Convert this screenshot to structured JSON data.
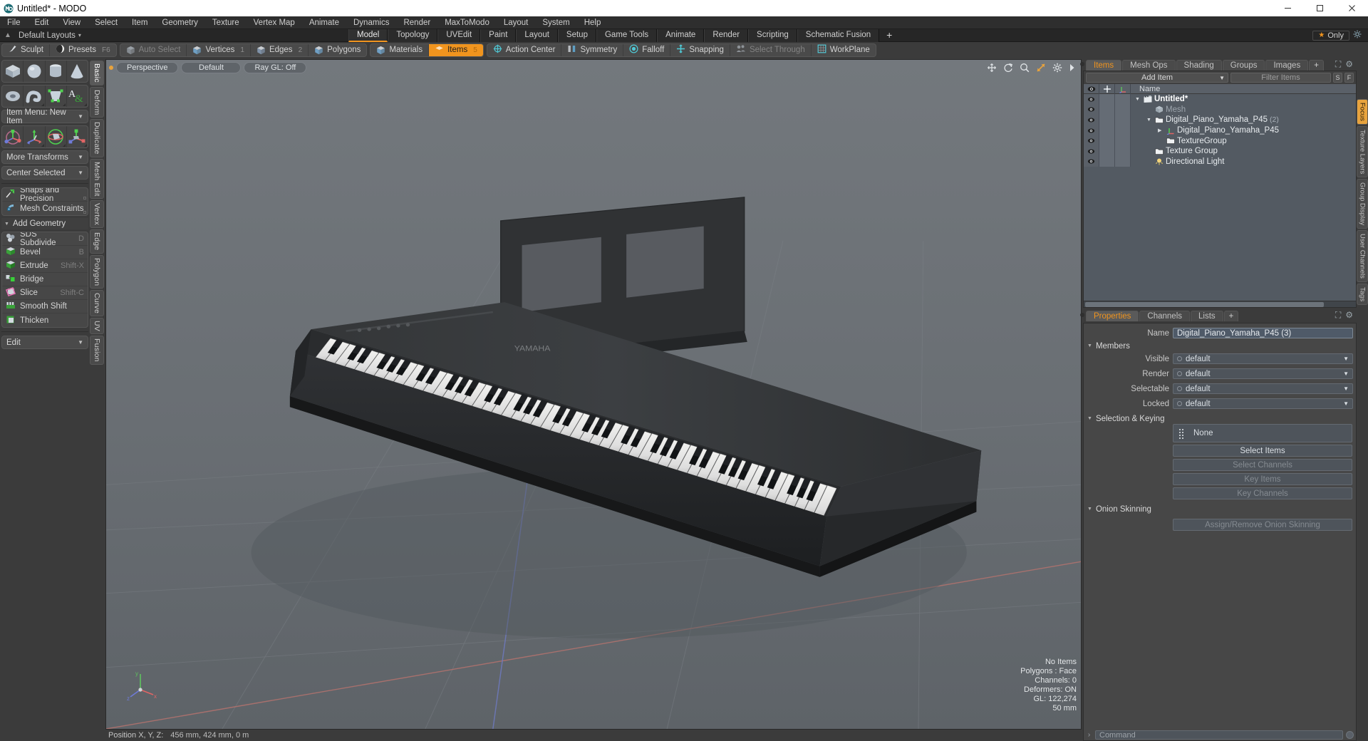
{
  "titlebar": {
    "title": "Untitled* - MODO",
    "minimize": "–",
    "maximize": "□",
    "close": "✕"
  },
  "menubar": {
    "items": [
      "File",
      "Edit",
      "View",
      "Select",
      "Item",
      "Geometry",
      "Texture",
      "Vertex Map",
      "Animate",
      "Dynamics",
      "Render",
      "MaxToModo",
      "Layout",
      "System",
      "Help"
    ]
  },
  "layoutbar": {
    "home_icon": "home-icon",
    "default_layouts": "Default Layouts",
    "caret": "▾",
    "tabs": [
      "Model",
      "Topology",
      "UVEdit",
      "Paint",
      "Layout",
      "Setup",
      "Game Tools",
      "Animate",
      "Render",
      "Scripting",
      "Schematic Fusion"
    ],
    "active_tab": "Model",
    "plus": "+",
    "only_label": "Only",
    "star": "★"
  },
  "selection_toolbar": {
    "left_group": [
      {
        "label": "Sculpt",
        "icon": "brush-icon",
        "shortcut": "",
        "state": "normal"
      },
      {
        "label": "Presets",
        "icon": "sphere-icon",
        "shortcut": "F6",
        "state": "normal"
      }
    ],
    "mode_group": [
      {
        "label": "Auto Select",
        "icon": "cube-grey-icon",
        "num": "",
        "state": "dim"
      },
      {
        "label": "Vertices",
        "icon": "cube-vertex-icon",
        "num": "1",
        "state": "normal"
      },
      {
        "label": "Edges",
        "icon": "cube-edge-icon",
        "num": "2",
        "state": "normal"
      },
      {
        "label": "Polygons",
        "icon": "cube-poly-icon",
        "num": "",
        "state": "normal"
      }
    ],
    "items_group": [
      {
        "label": "Materials",
        "icon": "cube-material-icon",
        "num": "",
        "state": "normal"
      },
      {
        "label": "Items",
        "icon": "cube-items-icon",
        "num": "5",
        "state": "active"
      }
    ],
    "action_group": [
      {
        "label": "Action Center",
        "icon": "action-center-icon",
        "state": "normal"
      },
      {
        "label": "Symmetry",
        "icon": "symmetry-icon",
        "state": "normal"
      },
      {
        "label": "Falloff",
        "icon": "falloff-icon",
        "state": "normal"
      },
      {
        "label": "Snapping",
        "icon": "snapping-icon",
        "state": "normal"
      },
      {
        "label": "Select Through",
        "icon": "select-through-icon",
        "state": "dim"
      },
      {
        "label": "WorkPlane",
        "icon": "workplane-icon",
        "state": "normal"
      }
    ]
  },
  "left_sidebar": {
    "primitive_row_1": [
      {
        "icon": "cube-primitive-icon",
        "name": "cube"
      },
      {
        "icon": "sphere-primitive-icon",
        "name": "sphere"
      },
      {
        "icon": "cylinder-primitive-icon",
        "name": "cylinder"
      },
      {
        "icon": "cone-primitive-icon",
        "name": "cone"
      }
    ],
    "primitive_row_2": [
      {
        "icon": "torus-primitive-icon",
        "name": "torus"
      },
      {
        "icon": "tube-primitive-icon",
        "name": "tube"
      },
      {
        "icon": "polygon-primitive-icon",
        "name": "polygon"
      },
      {
        "icon": "text-primitive-icon",
        "name": "text"
      }
    ],
    "item_menu": "Item Menu: New Item",
    "transform_row": [
      {
        "icon": "move-gizmo-icon",
        "name": "move"
      },
      {
        "icon": "rotate-gizmo-icon",
        "name": "rotate"
      },
      {
        "icon": "scale-gizmo-icon",
        "name": "scale"
      },
      {
        "icon": "transform-gizmo-icon",
        "name": "transform"
      }
    ],
    "more_transforms": "More Transforms",
    "center_selected": "Center Selected",
    "snaps": {
      "label": "Snaps and Precision",
      "icon": "snap-icon"
    },
    "mesh_constraints": {
      "label": "Mesh Constraints",
      "icon": "constraint-icon"
    },
    "add_geometry_header": "Add Geometry",
    "geometry_tools": [
      {
        "label": "SDS Subdivide",
        "shortcut": "D",
        "icon": "sds-icon"
      },
      {
        "label": "Bevel",
        "shortcut": "B",
        "icon": "bevel-icon"
      },
      {
        "label": "Extrude",
        "shortcut": "Shift-X",
        "icon": "extrude-icon"
      },
      {
        "label": "Bridge",
        "shortcut": "",
        "icon": "bridge-icon"
      },
      {
        "label": "Slice",
        "shortcut": "Shift-C",
        "icon": "slice-icon"
      },
      {
        "label": "Smooth Shift",
        "shortcut": "",
        "icon": "smooth-shift-icon"
      },
      {
        "label": "Thicken",
        "shortcut": "",
        "icon": "thicken-icon"
      }
    ],
    "edit_dropdown": "Edit",
    "vertical_tabs": [
      "Basic",
      "Deform",
      "Duplicate",
      "Mesh Edit",
      "Vertex",
      "Edge",
      "Polygon",
      "Curve",
      "UV",
      "Fusion"
    ],
    "vertical_tab_active": "Basic"
  },
  "viewport": {
    "dot": "viewport-indicator",
    "pills": [
      "Perspective",
      "Default",
      "Ray GL: Off"
    ],
    "icons": [
      "move-view-icon",
      "rotate-view-icon",
      "zoom-view-icon",
      "fit-view-icon",
      "settings-icon",
      "expand-arrow-icon"
    ],
    "stats": [
      "No Items",
      "Polygons : Face",
      "Channels: 0",
      "Deformers: ON",
      "GL: 122,274",
      "50 mm"
    ],
    "axis_gizmo": {
      "x": "x",
      "y": "y",
      "z": "z"
    }
  },
  "statusbar": {
    "label": "Position X, Y, Z:",
    "value": "456 mm, 424 mm, 0 m"
  },
  "right_panel": {
    "tabs": [
      "Items",
      "Mesh Ops",
      "Shading",
      "Groups",
      "Images"
    ],
    "active_tab": "Items",
    "plus": "+",
    "add_item": "Add Item",
    "filter_placeholder": "Filter Items",
    "small_buttons": [
      "S",
      "F"
    ],
    "tree_columns": [
      "eye-icon",
      "move-lock-icon",
      "axis-icon",
      "Name"
    ],
    "tree_rows": [
      {
        "label": "Untitled*",
        "indent": 0,
        "icon": "scene-icon",
        "expander": "down",
        "bold": true,
        "dim": false,
        "count": ""
      },
      {
        "label": "Mesh",
        "indent": 1,
        "icon": "mesh-icon",
        "expander": "none",
        "bold": false,
        "dim": true,
        "count": ""
      },
      {
        "label": "Digital_Piano_Yamaha_P45",
        "indent": 1,
        "icon": "group-icon",
        "expander": "down",
        "bold": false,
        "dim": false,
        "count": "(2)"
      },
      {
        "label": "Digital_Piano_Yamaha_P45",
        "indent": 2,
        "icon": "locator-icon",
        "expander": "right",
        "bold": false,
        "dim": false,
        "count": ""
      },
      {
        "label": "TextureGroup",
        "indent": 2,
        "icon": "group-icon",
        "expander": "none",
        "bold": false,
        "dim": false,
        "count": ""
      },
      {
        "label": "Texture Group",
        "indent": 1,
        "icon": "group-icon",
        "expander": "none",
        "bold": false,
        "dim": false,
        "count": ""
      },
      {
        "label": "Directional Light",
        "indent": 1,
        "icon": "light-icon",
        "expander": "none",
        "bold": false,
        "dim": false,
        "count": ""
      }
    ],
    "vertical_tabs": [
      "Focus",
      "Texture Layers",
      "Group Display",
      "User Channels",
      "Tags"
    ],
    "vertical_tab_active": "Focus"
  },
  "properties": {
    "tabs": [
      "Properties",
      "Channels",
      "Lists"
    ],
    "active_tab": "Properties",
    "plus": "+",
    "name_label": "Name",
    "name_value": "Digital_Piano_Yamaha_P45 (3)",
    "members_header": "Members",
    "member_rows": [
      {
        "label": "Visible",
        "value": "default"
      },
      {
        "label": "Render",
        "value": "default"
      },
      {
        "label": "Selectable",
        "value": "default"
      },
      {
        "label": "Locked",
        "value": "default"
      }
    ],
    "selection_header": "Selection & Keying",
    "selection_value": "None",
    "selection_buttons": [
      {
        "label": "Select Items",
        "enabled": true
      },
      {
        "label": "Select Channels",
        "enabled": false
      },
      {
        "label": "Key Items",
        "enabled": false
      },
      {
        "label": "Key Channels",
        "enabled": false
      }
    ],
    "onion_header": "Onion Skinning",
    "onion_button": {
      "label": "Assign/Remove Onion Skinning",
      "enabled": false
    }
  },
  "command": {
    "arrow": "›",
    "placeholder": "Command"
  },
  "colors": {
    "accent": "#f0941e",
    "panel": "#3b3b3b",
    "viewport": "#6b7075",
    "tree": "#535a62",
    "titlebar": "#ffffff"
  }
}
